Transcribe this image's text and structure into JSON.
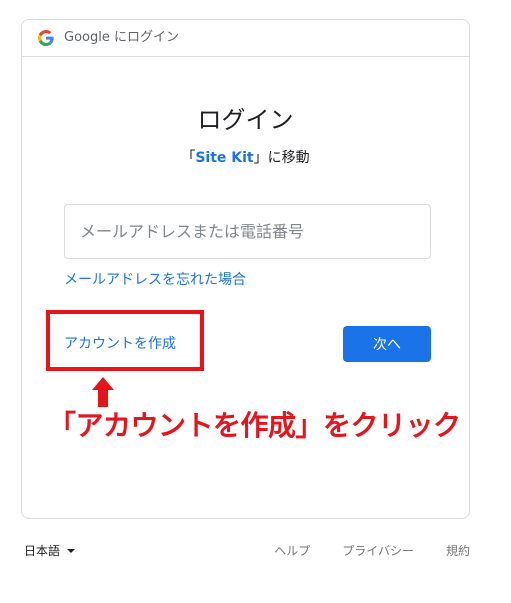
{
  "header": {
    "text": "Google にログイン"
  },
  "main": {
    "title": "ログイン",
    "subtitle_prefix": "「",
    "app_name": "Site Kit",
    "subtitle_suffix": "」に移動",
    "email_placeholder": "メールアドレスまたは電話番号",
    "forgot_email_link": "メールアドレスを忘れた場合",
    "create_account_link": "アカウントを作成",
    "next_button": "次へ"
  },
  "annotation": {
    "text": "「アカウントを作成」をクリック",
    "color": "#e8141c"
  },
  "footer": {
    "language": "日本語",
    "links": [
      "ヘルプ",
      "プライバシー",
      "規約"
    ]
  },
  "colors": {
    "primary": "#1a73e8",
    "border": "#dadce0",
    "annotation_red": "#e8141c"
  },
  "icons": [
    "google-g-icon",
    "chevron-down-icon",
    "arrow-up-icon"
  ]
}
